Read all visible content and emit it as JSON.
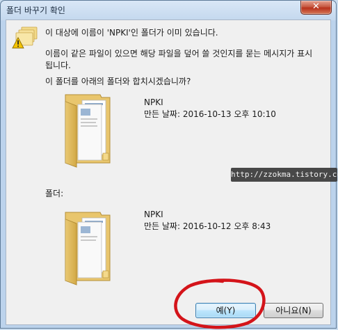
{
  "window": {
    "title": "폴더 바꾸기 확인",
    "close_symbol": "✕"
  },
  "message": {
    "line1": "이 대상에 이름이 'NPKI'인 폴더가 이미 있습니다.",
    "line2": "이름이 같은 파일이 있으면 해당 파일을 덮어 쓸 것인지를 묻는 메시지가 표시됩니다.",
    "line3": "이 폴더를 아래의 폴더와 합치시겠습니까?"
  },
  "source_folder": {
    "name": "NPKI",
    "date": "만든 날짜: 2016-10-13 오후 10:10"
  },
  "dest_label": "폴더:",
  "dest_folder": {
    "name": "NPKI",
    "date": "만든 날짜: 2016-10-12 오후 8:43"
  },
  "watermark": "http://zzokma.tistory.com",
  "buttons": {
    "yes": "예(Y)",
    "no": "아니요(N)"
  },
  "icons": [
    "warning-folder-icon",
    "folder-icon",
    "close-icon"
  ],
  "colors": {
    "highlight_circle": "#d4141a",
    "default_button_border": "#3c7fb1"
  }
}
